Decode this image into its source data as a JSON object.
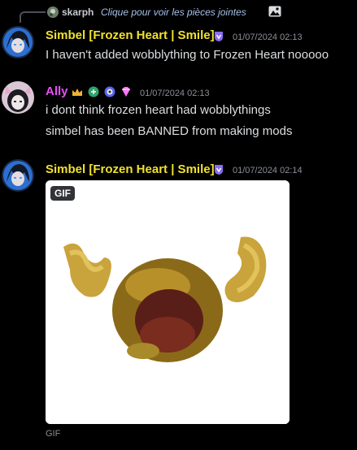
{
  "reply": {
    "name": "skarph",
    "text": "Clique pour voir les pièces jointes",
    "icon": "image-icon"
  },
  "messages": [
    {
      "author": "Simbel [Frozen Heart | Smile]",
      "author_color": "#f0e130",
      "timestamp": "01/07/2024 02:13",
      "lines": [
        "I haven't added wobblything to Frozen Heart nooooo"
      ]
    },
    {
      "author": "Ally",
      "author_color": "#e84ff7",
      "timestamp": "01/07/2024 02:13",
      "lines": [
        "i dont think frozen heart had wobblythings",
        "simbel has been BANNED from making mods"
      ]
    },
    {
      "author": "Simbel [Frozen Heart | Smile]",
      "author_color": "#f0e130",
      "timestamp": "01/07/2024 02:14",
      "attachment": {
        "tag": "GIF",
        "caption": "GIF"
      }
    }
  ],
  "colors": {
    "background": "#000000",
    "timestamp": "#8b8f96",
    "reply_link": "#a4c0e6"
  }
}
